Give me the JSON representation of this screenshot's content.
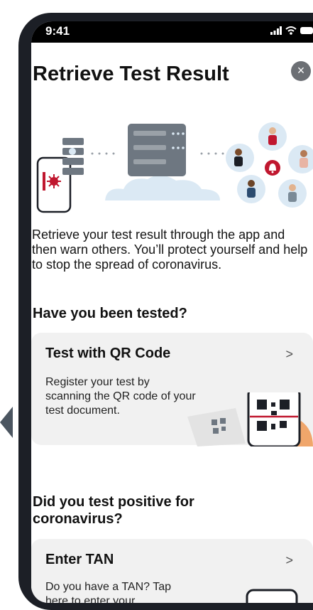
{
  "status_bar": {
    "time": "9:41",
    "icons": [
      "signal-icon",
      "wifi-icon",
      "battery-icon"
    ]
  },
  "header": {
    "title": "Retrieve Test Result",
    "close_icon": "close-icon"
  },
  "intro": {
    "text": "Retrieve your test result through the app and then warn others. You’ll protect yourself and help to stop the spread of coronavirus."
  },
  "sections": {
    "tested": {
      "heading": "Have you been tested?"
    },
    "positive": {
      "heading": "Did you test positive for coronavirus?"
    }
  },
  "cards": {
    "qr": {
      "title": "Test with QR Code",
      "description": "Register your test by scanning the QR code of your test document.",
      "chevron": ">"
    },
    "tan": {
      "title": "Enter TAN",
      "description": "Do you have a TAN? Tap here to enter your",
      "chevron": ">"
    }
  },
  "colors": {
    "accent_red": "#c0172f",
    "card_bg": "#f1f1f1",
    "cloud_blue": "#dbe9f4",
    "server_gray": "#6e7781"
  }
}
